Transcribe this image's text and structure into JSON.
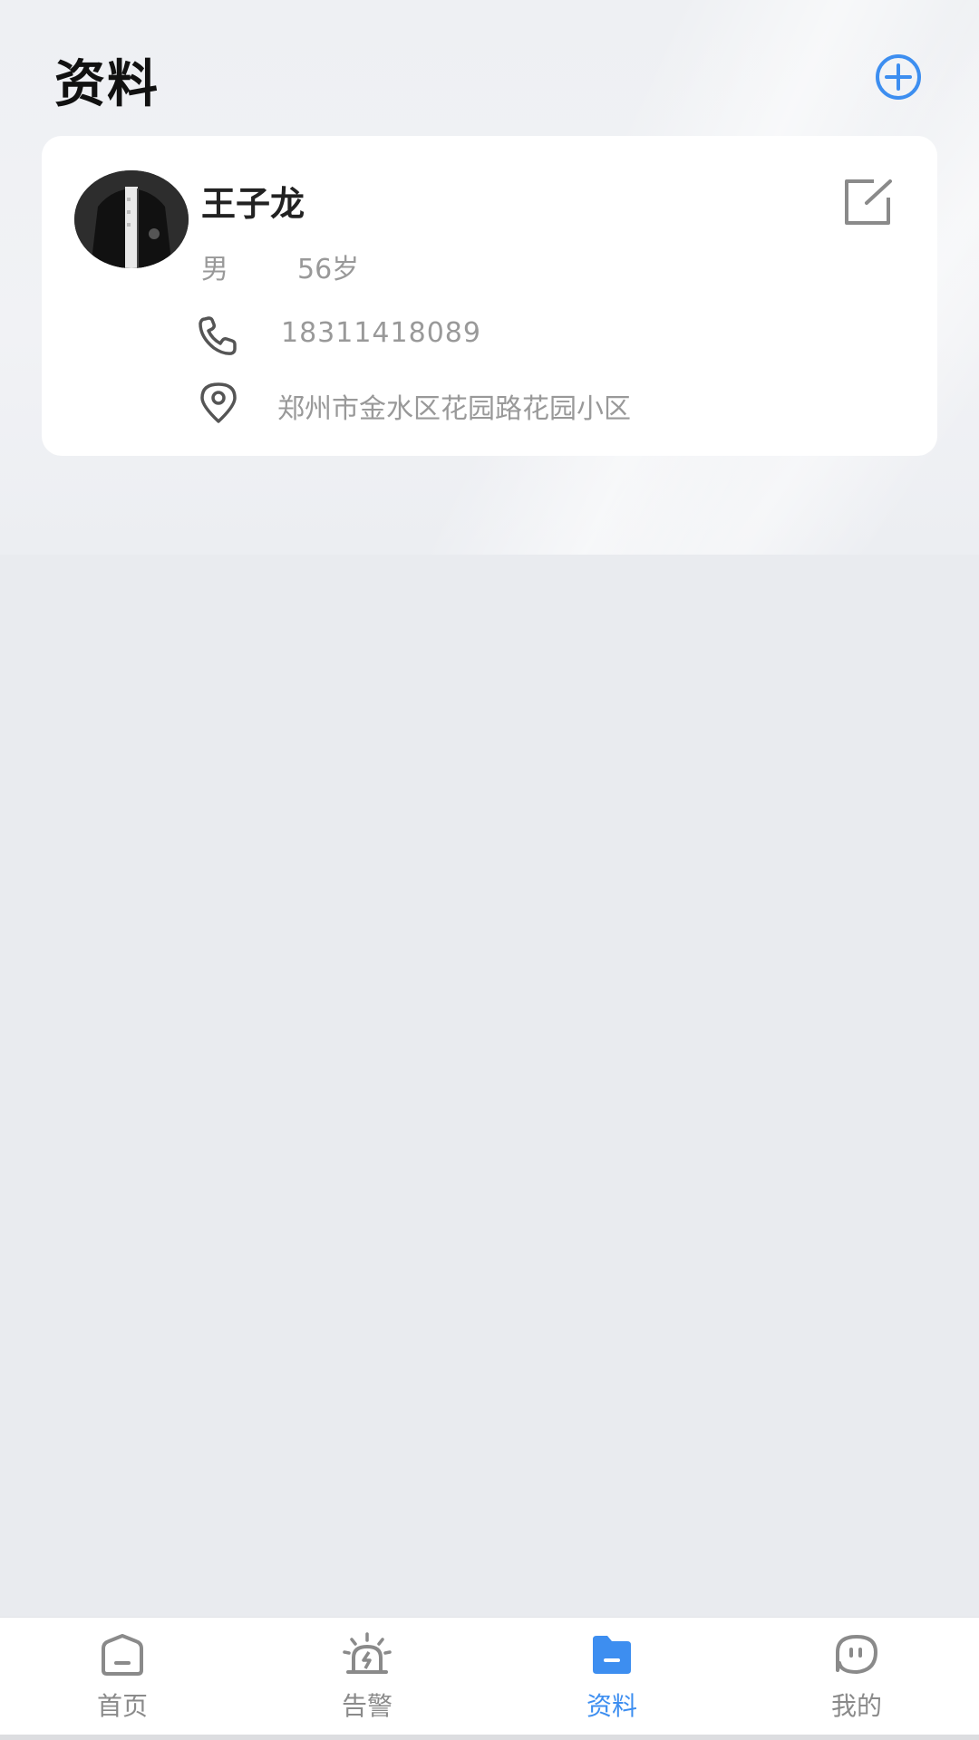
{
  "header": {
    "title": "资料",
    "add_icon": "plus-circle-icon",
    "accent_color": "#3d8ef0"
  },
  "profile": {
    "name": "王子龙",
    "gender": "男",
    "age": "56岁",
    "phone": "18311418089",
    "address": "郑州市金水区花园路花园小区",
    "edit_icon": "edit-icon",
    "phone_icon": "phone-icon",
    "location_icon": "location-pin-icon"
  },
  "tabbar": {
    "tabs": [
      {
        "label": "首页",
        "icon": "home-icon",
        "active": false
      },
      {
        "label": "告警",
        "icon": "alarm-icon",
        "active": false
      },
      {
        "label": "资料",
        "icon": "folder-icon",
        "active": true
      },
      {
        "label": "我的",
        "icon": "chat-face-icon",
        "active": false
      }
    ]
  }
}
